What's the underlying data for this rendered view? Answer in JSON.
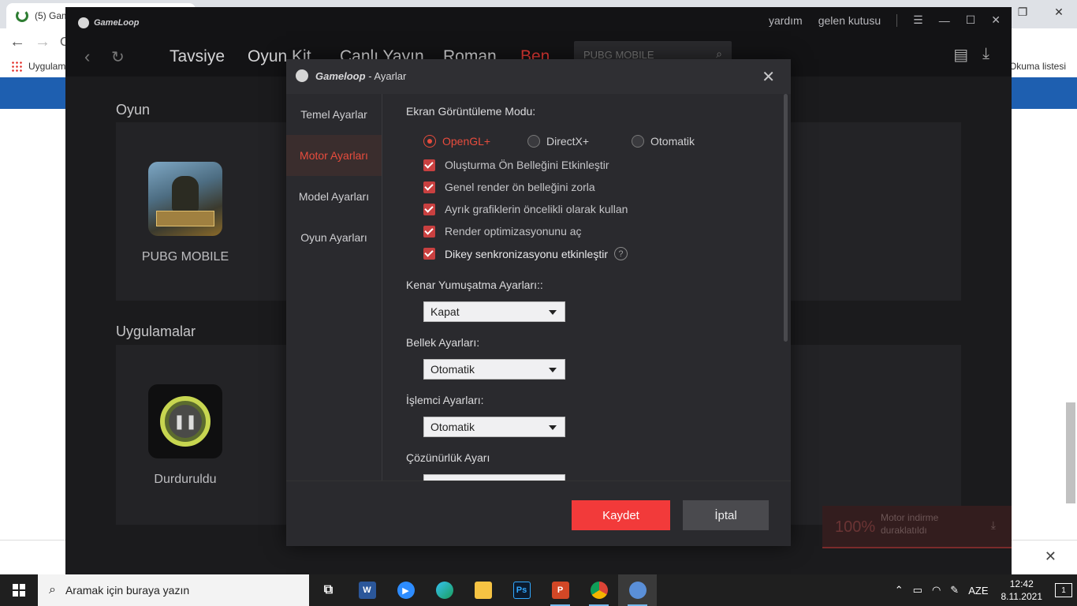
{
  "browser": {
    "tab_title": "(5) Gam",
    "bookmarks_apps": "Uygulam",
    "reading_list": "Okuma listesi",
    "address_partial": "C"
  },
  "gameloop": {
    "logo": "GameLoop",
    "top_links": [
      "yardım",
      "gelen kutusu"
    ],
    "nav": [
      "Tavsiye",
      "Oyun Kit",
      "Canlı Yayın",
      "Roman",
      "Ben"
    ],
    "search_placeholder": "PUBG MOBILE",
    "sections": {
      "games_title": "Oyun",
      "apps_title": "Uygulamalar"
    },
    "games": [
      {
        "label": "PUBG MOBILE"
      }
    ],
    "apps": [
      {
        "label": "Durduruldu"
      }
    ],
    "download": {
      "percent": "100%",
      "message_line1": "Motor indirme",
      "message_line2": "duraklatıldı"
    }
  },
  "dialog": {
    "title_brand": "Gameloop",
    "title_rest": " - Ayarlar",
    "close_symbol": "✕",
    "sidebar": [
      "Temel Ayarlar",
      "Motor Ayarları",
      "Model Ayarları",
      "Oyun Ayarları"
    ],
    "active_sidebar_index": 1,
    "display_mode_title": "Ekran Görüntüleme Modu:",
    "render_options": [
      "OpenGL+",
      "DirectX+",
      "Otomatik"
    ],
    "selected_render": "OpenGL+",
    "checkboxes": [
      {
        "label": "Oluşturma Ön Belleğini Etkinleştir",
        "checked": true
      },
      {
        "label": "Genel render ön belleğini zorla",
        "checked": true
      },
      {
        "label": "Ayrık grafiklerin öncelikli olarak kullan",
        "checked": true
      },
      {
        "label": "Render optimizasyonunu aç",
        "checked": true
      },
      {
        "label": "Dikey senkronizasyonu etkinleştir",
        "checked": true
      }
    ],
    "help_symbol": "?",
    "antialias_title": "Kenar Yumuşatma Ayarları::",
    "antialias_value": "Kapat",
    "memory_title": "Bellek Ayarları:",
    "memory_value": "Otomatik",
    "cpu_title": "İşlemci Ayarları:",
    "cpu_value": "Otomatik",
    "resolution_title": "Çözünürlük Ayarı",
    "save_label": "Kaydet",
    "cancel_label": "İptal"
  },
  "taskbar": {
    "search_placeholder": "Aramak için buraya yazın",
    "apps": [
      "task-view",
      "word",
      "zoom",
      "edge",
      "file-explorer",
      "photoshop",
      "powerpoint",
      "chrome",
      "gameloop"
    ],
    "language": "AZE",
    "time": "12:42",
    "date": "8.11.2021",
    "notifications": "1"
  },
  "colors": {
    "accent": "#e84c3d",
    "save_button": "#f23a3a",
    "dialog_bg": "#2a2a2e"
  }
}
